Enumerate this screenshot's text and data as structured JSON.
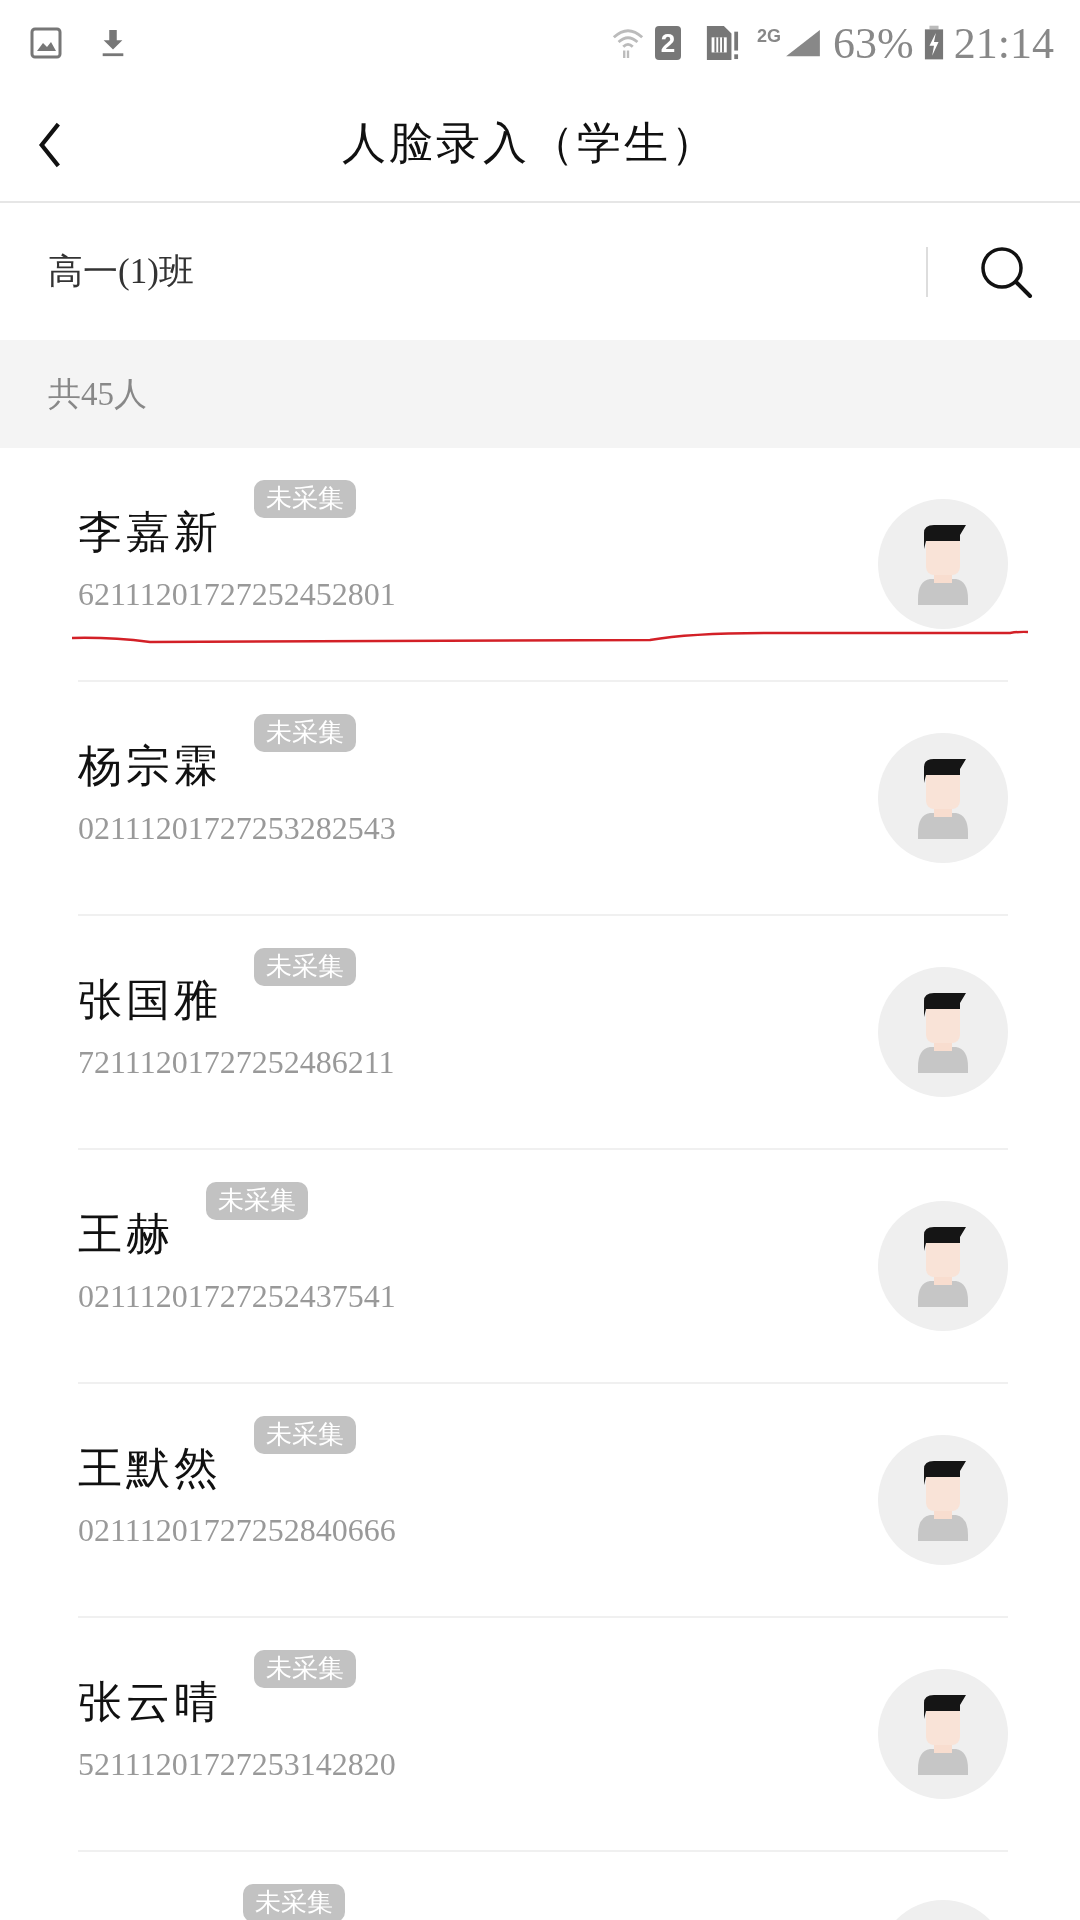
{
  "status_bar": {
    "sim_slot": "2",
    "network": "2G",
    "battery": "63%",
    "time": "21:14"
  },
  "header": {
    "title": "人脸录入（学生）"
  },
  "filter": {
    "class_name": "高一(1)班"
  },
  "count": "共45人",
  "students": [
    {
      "name": "李嘉新",
      "id": "62111201727252452801",
      "badge": "未采集"
    },
    {
      "name": "杨宗霖",
      "id": "02111201727253282543",
      "badge": "未采集"
    },
    {
      "name": "张国雅",
      "id": "72111201727252486211",
      "badge": "未采集"
    },
    {
      "name": "王赫",
      "id": "02111201727252437541",
      "badge": "未采集"
    },
    {
      "name": "王默然",
      "id": "02111201727252840666",
      "badge": "未采集"
    },
    {
      "name": "张云晴",
      "id": "52111201727253142820",
      "badge": "未采集"
    },
    {
      "badge": "未采集"
    }
  ]
}
